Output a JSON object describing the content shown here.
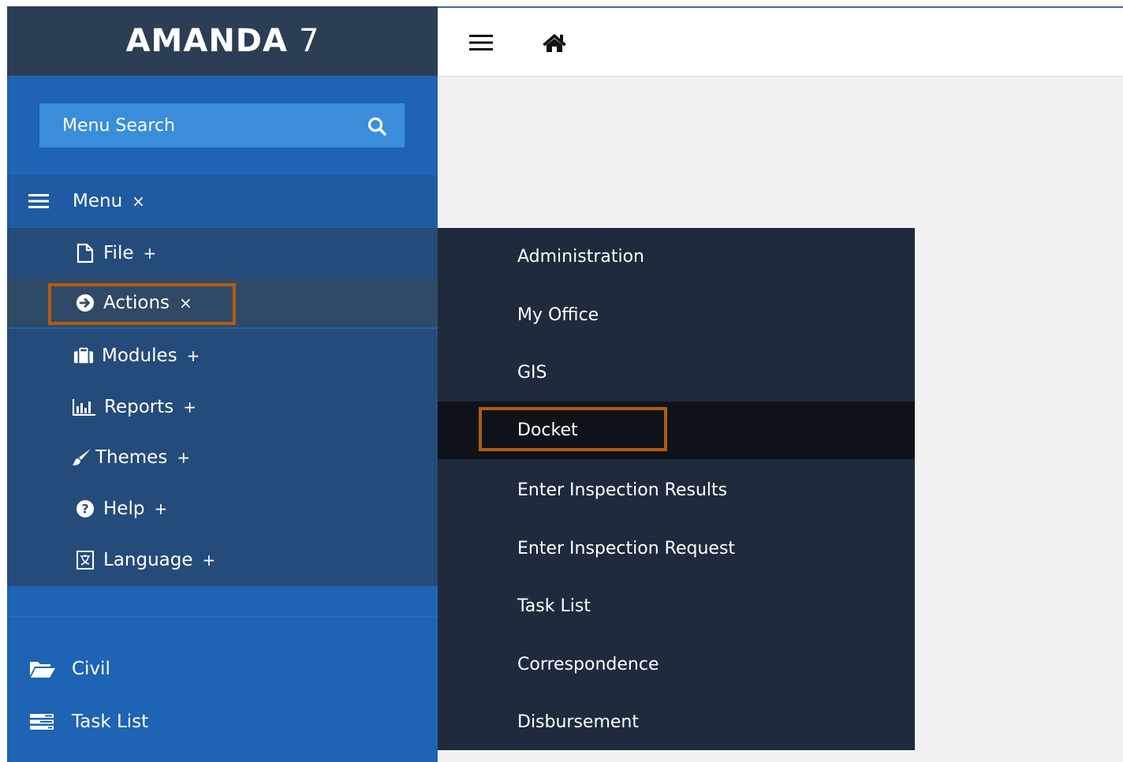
{
  "brand": {
    "name": "AMANDA",
    "version": "7"
  },
  "search": {
    "placeholder": "Menu Search",
    "icon": "search-icon"
  },
  "menu": {
    "label": "Menu",
    "close_symbol": "×",
    "items": [
      {
        "label": "File",
        "symbol": "+",
        "icon": "file-icon"
      },
      {
        "label": "Actions",
        "symbol": "×",
        "icon": "arrow-circle-right-icon",
        "active": true
      },
      {
        "label": "Modules",
        "symbol": "+",
        "icon": "briefcase-icon"
      },
      {
        "label": "Reports",
        "symbol": "+",
        "icon": "bar-chart-icon"
      },
      {
        "label": "Themes",
        "symbol": "+",
        "icon": "paintbrush-icon"
      },
      {
        "label": "Help",
        "symbol": "+",
        "icon": "question-circle-icon"
      },
      {
        "label": "Language",
        "symbol": "+",
        "icon": "language-icon"
      }
    ]
  },
  "bottom_items": [
    {
      "label": "Civil",
      "icon": "folder-open-icon"
    },
    {
      "label": "Task List",
      "icon": "tasks-icon"
    }
  ],
  "topbar": {
    "menu_icon": "hamburger-icon",
    "home_icon": "home-icon"
  },
  "submenu": {
    "items": [
      {
        "label": "Administration"
      },
      {
        "label": "My Office"
      },
      {
        "label": "GIS"
      },
      {
        "label": "Docket",
        "active": true
      },
      {
        "label": "Enter Inspection Results"
      },
      {
        "label": "Enter Inspection Request"
      },
      {
        "label": "Task List"
      },
      {
        "label": "Correspondence"
      },
      {
        "label": "Disbursement"
      }
    ]
  },
  "colors": {
    "sidebar_bg": "#1e63b4",
    "brand_bg": "#2c3e55",
    "submenu_bg": "#1f2b3c",
    "highlight": "#b45a0f"
  }
}
